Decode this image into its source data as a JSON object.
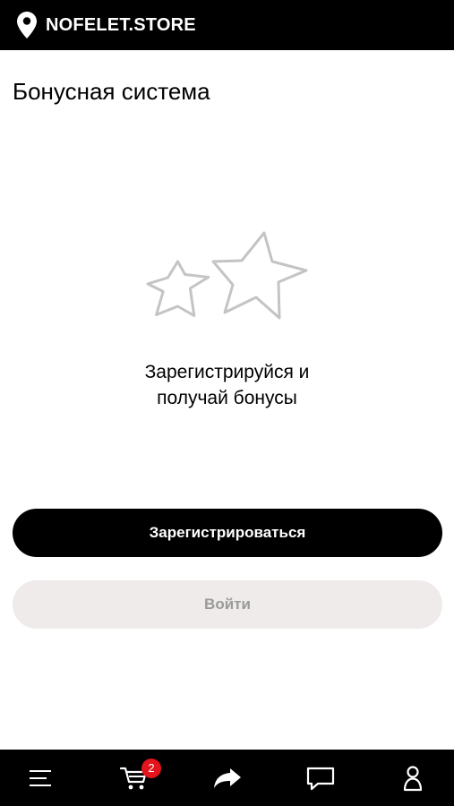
{
  "header": {
    "store_name": "NOFELET.STORE",
    "location_icon": "map-pin-icon"
  },
  "page": {
    "title": "Бонусная система"
  },
  "promo": {
    "icon": "stars-icon",
    "line1": "Зарегистрируйся и",
    "line2": "получай бонусы"
  },
  "actions": {
    "register_label": "Зарегистрироваться",
    "login_label": "Войти"
  },
  "bottom_nav": {
    "items": [
      {
        "icon": "menu-icon"
      },
      {
        "icon": "cart-icon",
        "badge": "2"
      },
      {
        "icon": "share-icon"
      },
      {
        "icon": "chat-icon"
      },
      {
        "icon": "profile-icon"
      }
    ]
  },
  "colors": {
    "bar_background": "#000000",
    "primary_button": "#000000",
    "secondary_button": "#efebea",
    "secondary_text": "#9a9a9a",
    "badge": "#e3141c",
    "stars_stroke": "#c4c4c4"
  }
}
